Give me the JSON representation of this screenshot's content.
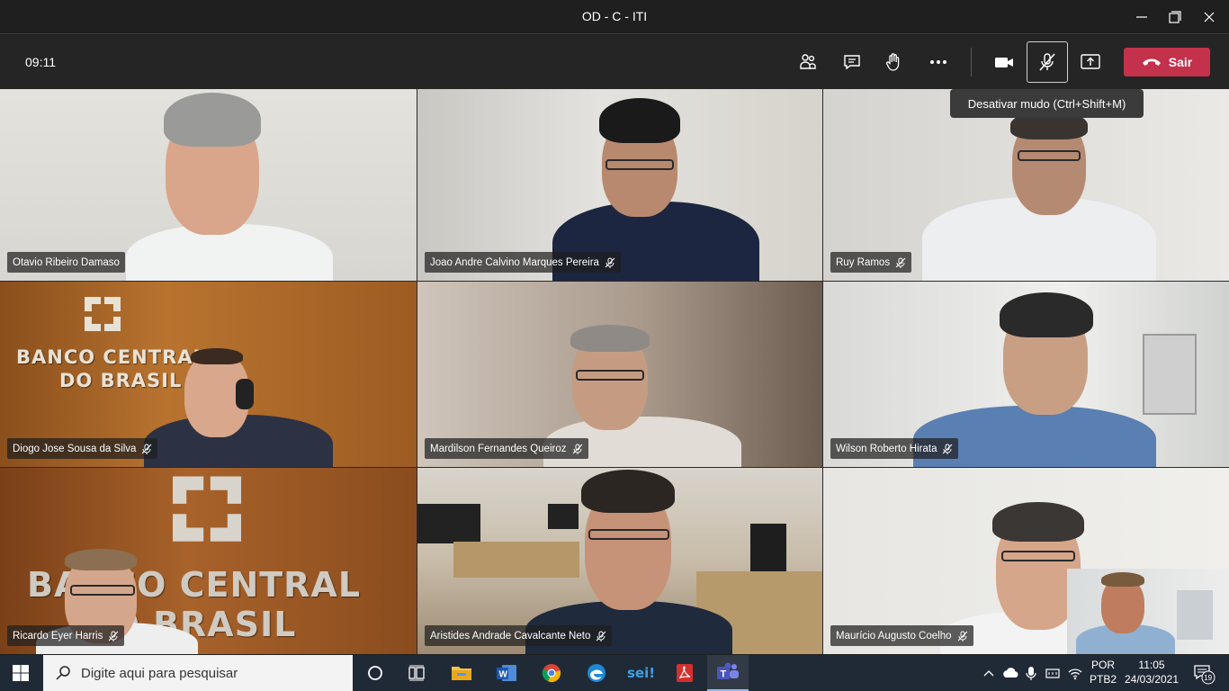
{
  "window": {
    "title": "OD - C - ITI"
  },
  "meeting": {
    "timer": "09:11",
    "leave_label": "Sair",
    "tooltip": "Desativar mudo (Ctrl+Shift+M)"
  },
  "participants": [
    {
      "name": "Otavio Ribeiro Damaso",
      "muted": false
    },
    {
      "name": "Joao Andre Calvino Marques Pereira",
      "muted": true
    },
    {
      "name": "Ruy Ramos",
      "muted": true
    },
    {
      "name": "Diogo Jose Sousa da Silva",
      "muted": true
    },
    {
      "name": "Mardilson Fernandes Queiroz",
      "muted": true
    },
    {
      "name": "Wilson Roberto Hirata",
      "muted": true
    },
    {
      "name": "Ricardo Eyer Harris",
      "muted": true
    },
    {
      "name": "Aristides Andrade Cavalcante Neto",
      "muted": true
    },
    {
      "name": "Maurício Augusto Coelho",
      "muted": true
    }
  ],
  "backgrounds": {
    "sign_line1": "BANCO CENTRAL",
    "sign_line2": "DO BRASIL",
    "sign2_line1": "BANCO CENTRAL",
    "sign2_line2": "DO BRASIL"
  },
  "taskbar": {
    "search_placeholder": "Digite aqui para pesquisar",
    "apps": [
      "cortana-icon",
      "task-view-icon",
      "file-explorer-icon",
      "word-icon",
      "chrome-icon",
      "edge-icon",
      "sei-icon",
      "acrobat-icon",
      "teams-icon"
    ],
    "sei_label": "sei!",
    "teams_label": "T",
    "word_label": "W",
    "lang_line1": "POR",
    "lang_line2": "PTB2",
    "time": "11:05",
    "date": "24/03/2021",
    "notification_count": "19"
  }
}
